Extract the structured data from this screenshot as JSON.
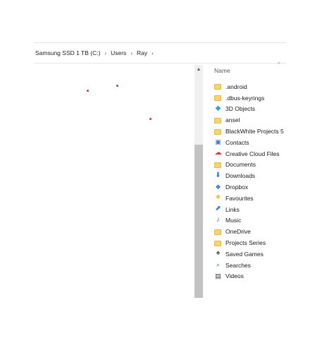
{
  "breadcrumb": {
    "items": [
      "Samsung SSD 1 TB (C:)",
      "Users",
      "Ray"
    ],
    "separator": "›"
  },
  "list": {
    "column_name": "Name",
    "items": [
      {
        "label": ".android",
        "icon": "folder-icon"
      },
      {
        "label": ".dbus-keyrings",
        "icon": "folder-icon"
      },
      {
        "label": "3D Objects",
        "icon": "3d-objects-icon"
      },
      {
        "label": "ansel",
        "icon": "folder-icon"
      },
      {
        "label": "BlackWhite Projects 5",
        "icon": "folder-icon"
      },
      {
        "label": "Contacts",
        "icon": "contacts-icon"
      },
      {
        "label": "Creative Cloud Files",
        "icon": "creative-cloud-icon"
      },
      {
        "label": "Documents",
        "icon": "folder-icon"
      },
      {
        "label": "Downloads",
        "icon": "download-arrow-icon"
      },
      {
        "label": "Dropbox",
        "icon": "dropbox-icon"
      },
      {
        "label": "Favourites",
        "icon": "star-icon"
      },
      {
        "label": "Links",
        "icon": "link-arrow-icon"
      },
      {
        "label": "Music",
        "icon": "music-note-icon"
      },
      {
        "label": "OneDrive",
        "icon": "folder-icon"
      },
      {
        "label": "Projects Series",
        "icon": "folder-icon"
      },
      {
        "label": "Saved Games",
        "icon": "saved-games-icon"
      },
      {
        "label": "Searches",
        "icon": "magnifier-icon"
      },
      {
        "label": "Videos",
        "icon": "film-icon"
      }
    ]
  }
}
